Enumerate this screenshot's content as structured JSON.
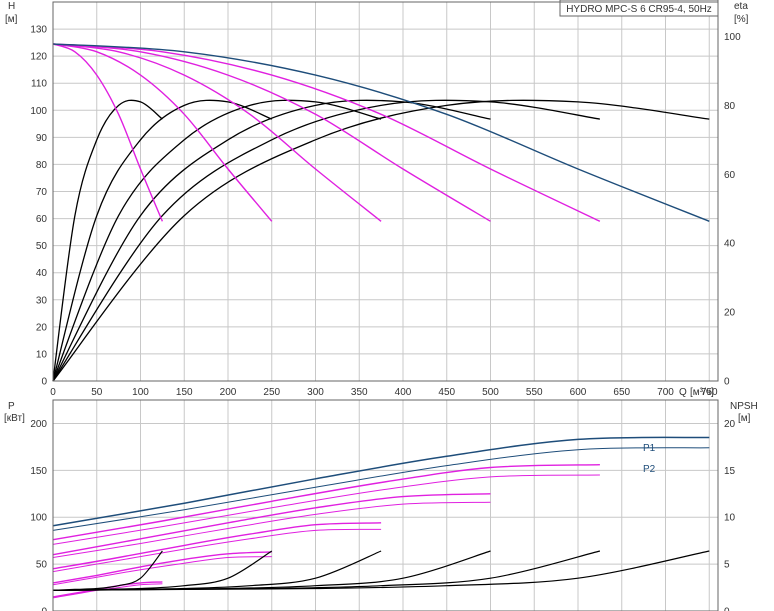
{
  "title": "HYDRO MPC-S 6 CR95-4, 50Hz",
  "colors": {
    "grid": "#c8c8c8",
    "frame": "#666666",
    "text": "#333333",
    "head_max": "#1e4d7a",
    "head_steps": "#e020e0",
    "eta": "#000000",
    "power_p1": "#1e4d7a",
    "power_p2": "#1e4d7a",
    "npsh": "#000000"
  },
  "chart_data": [
    {
      "type": "line",
      "name": "head",
      "ylabel": "H",
      "yunit": "[м]",
      "y2label": "eta",
      "y2unit": "[%]",
      "xlabel": "Q",
      "xunit": "[м³/ч]",
      "xlim": [
        0,
        760
      ],
      "ylim": [
        0,
        140
      ],
      "y2lim": [
        0,
        110
      ],
      "xticks": [
        0,
        50,
        100,
        150,
        200,
        250,
        300,
        350,
        400,
        450,
        500,
        550,
        600,
        650,
        700,
        750
      ],
      "yticks": [
        0,
        10,
        20,
        30,
        40,
        50,
        60,
        70,
        80,
        90,
        100,
        110,
        120,
        130
      ],
      "y2ticks": [
        0,
        20,
        40,
        60,
        80,
        100
      ],
      "grid": true,
      "head_curves": [
        {
          "pumps": 1,
          "x": [
            0,
            25,
            50,
            75,
            100,
            125
          ],
          "y": [
            124.5,
            121.6,
            113,
            98.5,
            78.3,
            59
          ]
        },
        {
          "pumps": 2,
          "x": [
            0,
            50,
            100,
            150,
            200,
            250
          ],
          "y": [
            124.5,
            121.6,
            113,
            98.5,
            78.3,
            59
          ]
        },
        {
          "pumps": 3,
          "x": [
            0,
            75,
            150,
            225,
            300,
            375
          ],
          "y": [
            124.5,
            121.6,
            113,
            98.5,
            78.3,
            59
          ]
        },
        {
          "pumps": 4,
          "x": [
            0,
            100,
            200,
            300,
            400,
            500
          ],
          "y": [
            124.5,
            121.6,
            113,
            98.5,
            78.3,
            59
          ]
        },
        {
          "pumps": 5,
          "x": [
            0,
            125,
            250,
            375,
            500,
            625
          ],
          "y": [
            124.5,
            121.6,
            113,
            98.5,
            78.3,
            59
          ]
        },
        {
          "pumps": 6,
          "x": [
            0,
            150,
            300,
            450,
            600,
            750
          ],
          "y": [
            124.5,
            121.6,
            113,
            98.5,
            78.3,
            59
          ]
        }
      ],
      "eta_curves": [
        {
          "pumps": 1,
          "x": [
            0,
            25,
            50,
            75,
            100,
            125
          ],
          "y": [
            0,
            48,
            70,
            80,
            81,
            76
          ]
        },
        {
          "pumps": 2,
          "x": [
            0,
            50,
            100,
            150,
            200,
            250
          ],
          "y": [
            0,
            48,
            70,
            80,
            81,
            76
          ]
        },
        {
          "pumps": 3,
          "x": [
            0,
            75,
            150,
            225,
            300,
            375
          ],
          "y": [
            0,
            48,
            70,
            80,
            81,
            76
          ]
        },
        {
          "pumps": 4,
          "x": [
            0,
            100,
            200,
            300,
            400,
            500
          ],
          "y": [
            0,
            48,
            70,
            80,
            81,
            76
          ]
        },
        {
          "pumps": 5,
          "x": [
            0,
            125,
            250,
            375,
            500,
            625
          ],
          "y": [
            0,
            48,
            70,
            80,
            81,
            76
          ]
        },
        {
          "pumps": 6,
          "x": [
            0,
            150,
            300,
            450,
            600,
            750
          ],
          "y": [
            0,
            48,
            70,
            80,
            81,
            76
          ]
        }
      ]
    },
    {
      "type": "line",
      "name": "power",
      "ylabel": "P",
      "yunit": "[кВт]",
      "y2label": "NPSH",
      "y2unit": "[м]",
      "xlim": [
        0,
        760
      ],
      "ylim": [
        0,
        225
      ],
      "y2lim": [
        0,
        22.5
      ],
      "yticks": [
        0,
        50,
        100,
        150,
        200
      ],
      "y2ticks": [
        0,
        5,
        10,
        15,
        20
      ],
      "grid": true,
      "series_labels": [
        "P1",
        "P2"
      ],
      "p1_curves": [
        {
          "pumps": 1,
          "x": [
            0,
            25,
            50,
            75,
            100,
            125
          ],
          "y": [
            15,
            19,
            23,
            27,
            30,
            31
          ]
        },
        {
          "pumps": 2,
          "x": [
            0,
            50,
            100,
            150,
            200,
            250
          ],
          "y": [
            30,
            38,
            47,
            55,
            61,
            63
          ]
        },
        {
          "pumps": 3,
          "x": [
            0,
            75,
            150,
            225,
            300,
            375
          ],
          "y": [
            45,
            57,
            70,
            82,
            92,
            94
          ]
        },
        {
          "pumps": 4,
          "x": [
            0,
            100,
            200,
            300,
            400,
            500
          ],
          "y": [
            60,
            77,
            94,
            110,
            122,
            125
          ]
        },
        {
          "pumps": 5,
          "x": [
            0,
            125,
            250,
            375,
            500,
            625
          ],
          "y": [
            76,
            96,
            117,
            137,
            153,
            156
          ]
        },
        {
          "pumps": 6,
          "x": [
            0,
            150,
            300,
            450,
            600,
            750
          ],
          "y": [
            91,
            115,
            141,
            165,
            183,
            185
          ]
        }
      ],
      "p2_curves": [
        {
          "pumps": 1,
          "x": [
            0,
            25,
            50,
            75,
            100,
            125
          ],
          "y": [
            14,
            18,
            22,
            25,
            28,
            29
          ]
        },
        {
          "pumps": 2,
          "x": [
            0,
            50,
            100,
            150,
            200,
            250
          ],
          "y": [
            28,
            36,
            44,
            51,
            57,
            58
          ]
        },
        {
          "pumps": 3,
          "x": [
            0,
            75,
            150,
            225,
            300,
            375
          ],
          "y": [
            42,
            54,
            66,
            77,
            86,
            87
          ]
        },
        {
          "pumps": 4,
          "x": [
            0,
            100,
            200,
            300,
            400,
            500
          ],
          "y": [
            57,
            72,
            88,
            103,
            114,
            116
          ]
        },
        {
          "pumps": 5,
          "x": [
            0,
            125,
            250,
            375,
            500,
            625
          ],
          "y": [
            71,
            90,
            110,
            129,
            143,
            145
          ]
        },
        {
          "pumps": 6,
          "x": [
            0,
            150,
            300,
            450,
            600,
            750
          ],
          "y": [
            86,
            108,
            132,
            155,
            172,
            174
          ]
        }
      ],
      "npsh_curves": [
        {
          "pumps": 1,
          "x": [
            0,
            25,
            50,
            75,
            100,
            125
          ],
          "y": [
            2.2,
            2.3,
            2.4,
            2.7,
            3.5,
            6.4
          ]
        },
        {
          "pumps": 2,
          "x": [
            0,
            50,
            100,
            150,
            200,
            250
          ],
          "y": [
            2.2,
            2.3,
            2.4,
            2.7,
            3.5,
            6.4
          ]
        },
        {
          "pumps": 3,
          "x": [
            0,
            75,
            150,
            225,
            300,
            375
          ],
          "y": [
            2.2,
            2.3,
            2.4,
            2.7,
            3.5,
            6.4
          ]
        },
        {
          "pumps": 4,
          "x": [
            0,
            100,
            200,
            300,
            400,
            500
          ],
          "y": [
            2.2,
            2.3,
            2.4,
            2.7,
            3.5,
            6.4
          ]
        },
        {
          "pumps": 5,
          "x": [
            0,
            125,
            250,
            375,
            500,
            625
          ],
          "y": [
            2.2,
            2.3,
            2.4,
            2.7,
            3.5,
            6.4
          ]
        },
        {
          "pumps": 6,
          "x": [
            0,
            150,
            300,
            450,
            600,
            750
          ],
          "y": [
            2.2,
            2.3,
            2.4,
            2.7,
            3.5,
            6.4
          ]
        }
      ]
    }
  ]
}
